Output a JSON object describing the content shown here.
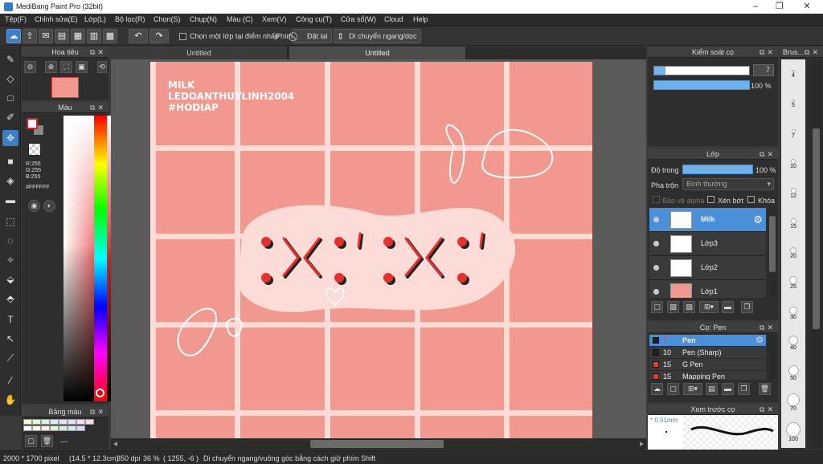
{
  "window": {
    "title": "MediBang Paint Pro (32bit)",
    "min": "–",
    "max": "❐",
    "close": "✕"
  },
  "menu": [
    "Tệp(F)",
    "Chỉnh sửa(E)",
    "Lớp(L)",
    "Bộ lọc(R)",
    "Chọn(S)",
    "Chụp(N)",
    "Màu (C)",
    "Xem(V)",
    "Công cụ(T)",
    "Cửa sổ(W)",
    "Cloud",
    "Help"
  ],
  "toolbar": {
    "snap_checkbox_label": "Chọn một lớp tại điểm nhấp",
    "snap_label": "Phím",
    "reset_label": "Đặt lại",
    "move_label": "Di chuyển ngang/dọc"
  },
  "navigator": {
    "title": "Hoa tiêu"
  },
  "color": {
    "title": "Màu",
    "r": "R:255",
    "g": "G:255",
    "b": "B:255",
    "hex": "#FFFFFF",
    "foreground": "#ffffff",
    "background": "#888888"
  },
  "palette": {
    "title": "Bảng màu",
    "footer": "---",
    "colors": [
      "#fff7c6",
      "#e8f7d0",
      "#d7f3e7",
      "#d3eef8",
      "#d9e2fb",
      "#e4dcfa",
      "#f3dcf6",
      "#fadada",
      "#ffffff",
      "#f2f2f2",
      "#fff0cc",
      "#e3f5cf",
      "#cfeed9",
      "#cfe9f6",
      "#d3dcf5"
    ]
  },
  "tabs": [
    "Untitled",
    "Untitled"
  ],
  "artwork": {
    "lines": [
      "MILK",
      "LEDOANTHUYLINH2004",
      "#HODIAP"
    ],
    "emote": ":>< :' :>< :'",
    "grid_color": "#fddbd6",
    "bg_color": "#f2998f"
  },
  "brush_control": {
    "title": "Kiểm soát cọ",
    "size": "7",
    "opacity": "100 %",
    "opacity_value": 1.0
  },
  "layers": {
    "title": "Lớp",
    "opacity_label": "Độ trong",
    "opacity": "100 %",
    "blend_label": "Pha trộn",
    "blend": "Bình thường",
    "protect_alpha": "Bảo vệ alpha",
    "clipping": "Xén bớt",
    "lock": "Khóa",
    "items": [
      {
        "name": "Milk",
        "selected": true
      },
      {
        "name": "Lớp3",
        "selected": false
      },
      {
        "name": "Lớp2",
        "selected": false
      },
      {
        "name": "Lớp1",
        "selected": false
      }
    ]
  },
  "brushes": {
    "title": "Cọ: Pen",
    "items": [
      {
        "size": "7",
        "name": "Pen",
        "color": "#222222",
        "selected": true
      },
      {
        "size": "10",
        "name": "Pen (Sharp)",
        "color": "#222222",
        "selected": false
      },
      {
        "size": "15",
        "name": "G Pen",
        "color": "#e53935",
        "selected": false
      },
      {
        "size": "15",
        "name": "Mapping Pen",
        "color": "#e53935",
        "selected": false
      }
    ]
  },
  "brush_preview": {
    "title": "Xem trước cọ",
    "size": "* 0.51mm"
  },
  "brush_sizes": {
    "title": "Brus...",
    "items": [
      "4",
      "5",
      "7",
      "10",
      "12",
      "15",
      "20",
      "25",
      "30",
      "40",
      "50",
      "70",
      "100"
    ]
  },
  "status": {
    "size": "2000 * 1700 pixel",
    "cm": "(14.5 * 12.3cm)",
    "dpi": "350 dpi",
    "zoom": "36 %",
    "coords": "( 1255, -6 )",
    "hint": "Di chuyển ngang/vuông góc bằng cách giữ phím Shift"
  }
}
